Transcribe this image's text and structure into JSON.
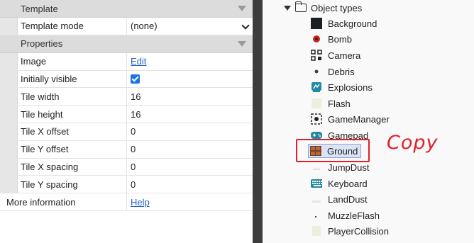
{
  "properties": {
    "template_section": "Template",
    "template_mode_label": "Template mode",
    "template_mode_value": "(none)",
    "properties_section": "Properties",
    "rows": [
      {
        "label": "Image",
        "value": "Edit",
        "kind": "link"
      },
      {
        "label": "Initially visible",
        "value": "",
        "kind": "checkbox",
        "checked": true
      },
      {
        "label": "Tile width",
        "value": "16",
        "kind": "text"
      },
      {
        "label": "Tile height",
        "value": "16",
        "kind": "text"
      },
      {
        "label": "Tile X offset",
        "value": "0",
        "kind": "text"
      },
      {
        "label": "Tile Y offset",
        "value": "0",
        "kind": "text"
      },
      {
        "label": "Tile X spacing",
        "value": "0",
        "kind": "text"
      },
      {
        "label": "Tile Y spacing",
        "value": "0",
        "kind": "text"
      }
    ],
    "more_info_label": "More information",
    "more_info_link": "Help"
  },
  "tree": {
    "folder_label": "Object types",
    "items": [
      {
        "label": "Background",
        "icon": "background-icon"
      },
      {
        "label": "Bomb",
        "icon": "bomb-icon"
      },
      {
        "label": "Camera",
        "icon": "camera-icon"
      },
      {
        "label": "Debris",
        "icon": "debris-icon"
      },
      {
        "label": "Explosions",
        "icon": "explosions-icon"
      },
      {
        "label": "Flash",
        "icon": "flash-icon"
      },
      {
        "label": "GameManager",
        "icon": "gamemanager-icon"
      },
      {
        "label": "Gamepad",
        "icon": "gamepad-icon"
      },
      {
        "label": "Ground",
        "icon": "ground-icon",
        "selected": true
      },
      {
        "label": "JumpDust",
        "icon": "jumpdust-icon"
      },
      {
        "label": "Keyboard",
        "icon": "keyboard-icon"
      },
      {
        "label": "LandDust",
        "icon": "landdust-icon"
      },
      {
        "label": "MuzzleFlash",
        "icon": "muzzleflash-icon"
      },
      {
        "label": "PlayerCollision",
        "icon": "playercollision-icon"
      }
    ]
  },
  "annotation": {
    "label": "Copy",
    "color": "#e0202a"
  }
}
